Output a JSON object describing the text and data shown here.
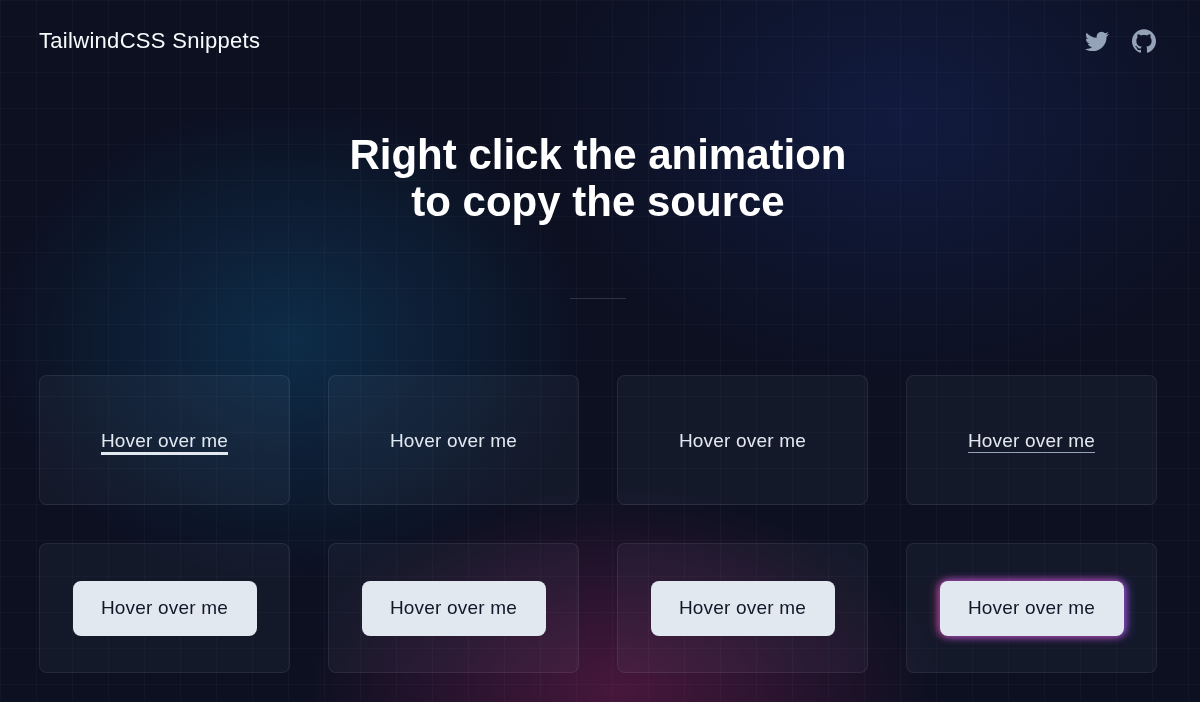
{
  "header": {
    "title": "TailwindCSS Snippets",
    "links": [
      {
        "kind": "bird"
      },
      {
        "kind": "cat"
      }
    ]
  },
  "hero": {
    "heading_lines": [
      "Right click the animation",
      "to copy the source"
    ]
  },
  "snippets": [
    {
      "kind": "underline",
      "label": "Hover over me"
    },
    {
      "kind": "plain",
      "label": "Hover over me"
    },
    {
      "kind": "plain",
      "label": "Hover over me"
    },
    {
      "kind": "hairline",
      "label": "Hover over me"
    },
    {
      "kind": "button",
      "label": "Hover over me",
      "glow": false
    },
    {
      "kind": "button",
      "label": "Hover over me",
      "glow": false
    },
    {
      "kind": "button",
      "label": "Hover over me",
      "glow": false
    },
    {
      "kind": "button",
      "label": "Hover over me",
      "glow": true
    }
  ]
}
